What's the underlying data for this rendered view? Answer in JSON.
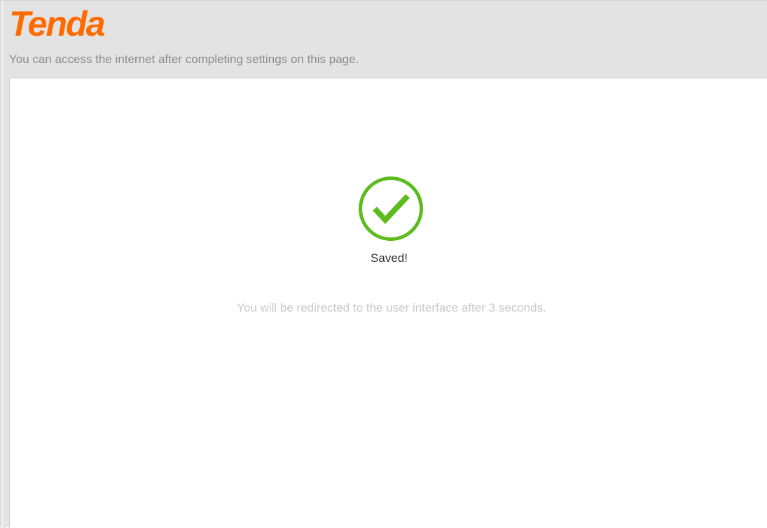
{
  "brand": {
    "logo_text": "Tenda",
    "logo_color": "#ff6b00"
  },
  "header": {
    "subtitle": "You can access the internet after completing settings on this page."
  },
  "result": {
    "icon": "checkmark-circle-icon",
    "icon_color": "#5dbb1e",
    "status": "Saved!",
    "redirect_message": "You will be redirected to the user interface after 3 seconds."
  }
}
